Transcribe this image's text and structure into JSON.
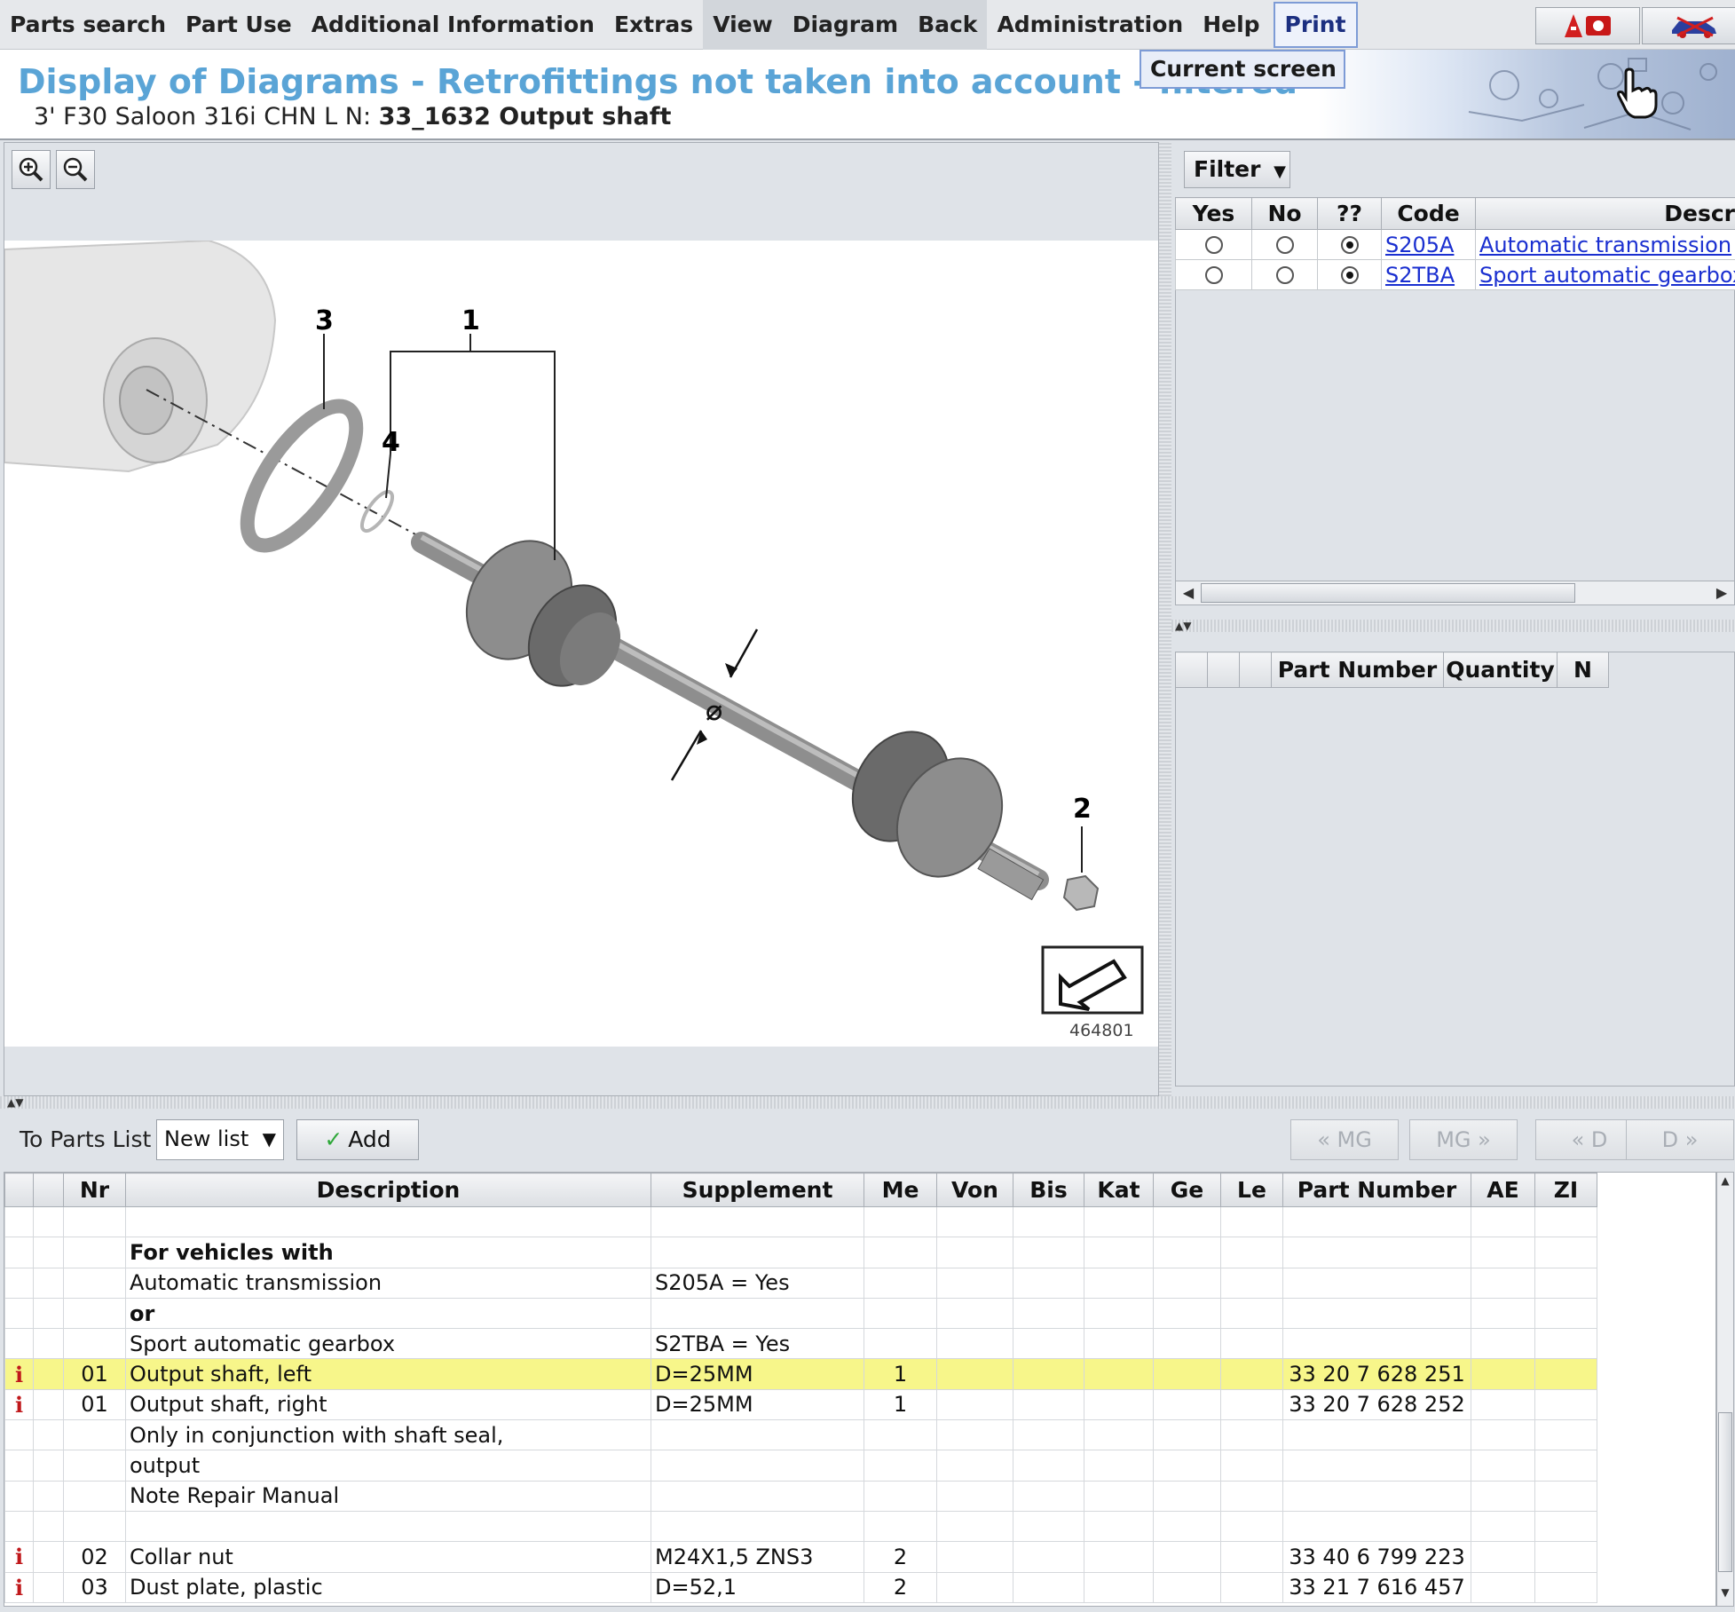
{
  "menu": {
    "items": [
      "Parts search",
      "Part Use",
      "Additional Information",
      "Extras",
      "View",
      "Diagram",
      "Back",
      "Administration",
      "Help",
      "Print"
    ],
    "dropdown_item": "Current screen"
  },
  "header": {
    "title": "Display of Diagrams - Retrofittings not taken into account - filtered",
    "vehicle": "3' F30 Saloon 316i CHN  L N: ",
    "diagram": "33_1632 Output shaft"
  },
  "diagram": {
    "callouts": [
      "1",
      "2",
      "3",
      "4"
    ],
    "image_number": "464801",
    "diameter_symbol": "⌀"
  },
  "filter": {
    "button_label": "Filter",
    "columns": [
      "Yes",
      "No",
      "??",
      "Code",
      "Descr"
    ],
    "rows": [
      {
        "yes": false,
        "no": false,
        "unknown": true,
        "code": "S205A",
        "description": "Automatic transmission"
      },
      {
        "yes": false,
        "no": false,
        "unknown": true,
        "code": "S2TBA",
        "description": "Sport automatic gearbox"
      }
    ]
  },
  "parts_list_panel": {
    "columns": [
      "",
      "",
      "",
      "Part Number",
      "Quantity",
      "N"
    ]
  },
  "toolbar": {
    "to_parts_list_label": "To Parts List",
    "list_selection": "New list",
    "add_label": "Add",
    "nav_buttons": [
      "« MG",
      "MG »",
      "« D",
      "D »"
    ]
  },
  "parts_table": {
    "columns": [
      "",
      "",
      "Nr",
      "Description",
      "Supplement",
      "Me",
      "Von",
      "Bis",
      "Kat",
      "Ge",
      "Le",
      "Part Number",
      "AE",
      "ZI"
    ],
    "rows": [
      {
        "info": "",
        "nr": "",
        "description": "",
        "supplement": "",
        "me": "",
        "part_number": "",
        "bold": false,
        "highlight": false
      },
      {
        "info": "",
        "nr": "",
        "description": "For vehicles with",
        "supplement": "",
        "me": "",
        "part_number": "",
        "bold": true,
        "highlight": false
      },
      {
        "info": "",
        "nr": "",
        "description": "Automatic transmission",
        "supplement": "S205A = Yes",
        "me": "",
        "part_number": "",
        "bold": false,
        "highlight": false
      },
      {
        "info": "",
        "nr": "",
        "description": "or",
        "supplement": "",
        "me": "",
        "part_number": "",
        "bold": true,
        "highlight": false
      },
      {
        "info": "",
        "nr": "",
        "description": "Sport automatic gearbox",
        "supplement": "S2TBA = Yes",
        "me": "",
        "part_number": "",
        "bold": false,
        "highlight": false
      },
      {
        "info": "i",
        "nr": "01",
        "description": "Output shaft, left",
        "supplement": "D=25MM",
        "me": "1",
        "part_number": "33 20 7 628 251",
        "bold": false,
        "highlight": true
      },
      {
        "info": "i",
        "nr": "01",
        "description": "Output shaft, right",
        "supplement": "D=25MM",
        "me": "1",
        "part_number": "33 20 7 628 252",
        "bold": false,
        "highlight": false
      },
      {
        "info": "",
        "nr": "",
        "description": "Only in conjunction with shaft seal,",
        "supplement": "",
        "me": "",
        "part_number": "",
        "bold": false,
        "highlight": false
      },
      {
        "info": "",
        "nr": "",
        "description": "output",
        "supplement": "",
        "me": "",
        "part_number": "",
        "bold": false,
        "highlight": false
      },
      {
        "info": "",
        "nr": "",
        "description": "Note Repair Manual",
        "supplement": "",
        "me": "",
        "part_number": "",
        "bold": false,
        "highlight": false
      },
      {
        "info": "",
        "nr": "",
        "description": "",
        "supplement": "",
        "me": "",
        "part_number": "",
        "bold": false,
        "highlight": false
      },
      {
        "info": "i",
        "nr": "02",
        "description": "Collar nut",
        "supplement": "M24X1,5 ZNS3",
        "me": "2",
        "part_number": "33 40 6 799 223",
        "bold": false,
        "highlight": false
      },
      {
        "info": "i",
        "nr": "03",
        "description": "Dust plate, plastic",
        "supplement": "D=52,1",
        "me": "2",
        "part_number": "33 21 7 616 457",
        "bold": false,
        "highlight": false
      }
    ]
  },
  "colors": {
    "title": "#5aa4d6",
    "highlight_row": "#f7f68a",
    "link": "#1a2fd0",
    "info_icon": "#c0181b"
  }
}
